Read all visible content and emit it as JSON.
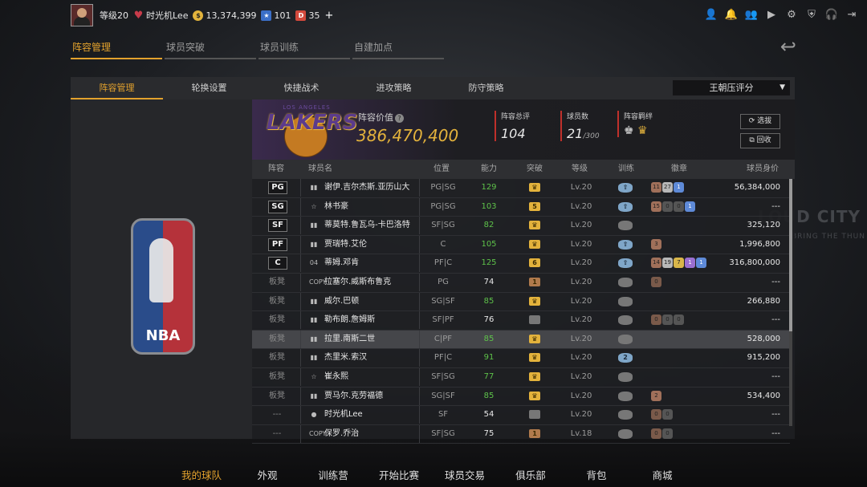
{
  "topbar": {
    "level": "等级20",
    "username": "时光机Lee",
    "coins": "13,374,399",
    "stars": "101",
    "tickets": "35",
    "plus": "+"
  },
  "top_tabs": [
    "阵容管理",
    "球员突破",
    "球员训练",
    "自建加点"
  ],
  "sub_tabs": [
    "阵容管理",
    "轮换设置",
    "快捷战术",
    "进攻策略",
    "防守策略"
  ],
  "sort_select": "王朝压评分",
  "team": {
    "logo_top_text": "LOS ANGELES",
    "logo_word": "LAKERS",
    "value_label": "阵容价值",
    "value": "386,470,400",
    "overall_label": "阵容总评",
    "overall": "104",
    "players_label": "球员数",
    "players": "21",
    "players_max": "/300",
    "bonds_label": "阵容羁绊",
    "btn_select": "选拔",
    "btn_recycle": "回收"
  },
  "left_logo": "NBA",
  "bg_text": "LOUD CITY",
  "bg_text2": "BRING THE THUN",
  "columns": [
    "阵容",
    "球员名",
    "位置",
    "能力",
    "突破",
    "等级",
    "训练",
    "徽章",
    "球员身价"
  ],
  "rows": [
    {
      "slot": "PG",
      "type": "bar",
      "name": "谢伊.吉尔杰斯.亚历山大",
      "pos": "PG|SG",
      "rating": "129",
      "green": true,
      "brk": "crown",
      "level": "Lv.20",
      "train": "up",
      "badges": [
        [
          "11",
          "br"
        ],
        [
          "27",
          "si"
        ],
        [
          "1",
          "bl"
        ]
      ],
      "worth": "56,384,000"
    },
    {
      "slot": "SG",
      "type": "star",
      "name": "林书豪",
      "pos": "PG|SG",
      "rating": "103",
      "green": true,
      "brk": "5",
      "level": "Lv.20",
      "train": "up",
      "badges": [
        [
          "15",
          "br"
        ],
        [
          "0",
          "dk"
        ],
        [
          "0",
          "dk"
        ],
        [
          "1",
          "bl"
        ]
      ],
      "worth": "---"
    },
    {
      "slot": "SF",
      "type": "bar",
      "name": "蒂莫特.鲁瓦乌-卡巴洛特",
      "pos": "SF|SG",
      "rating": "82",
      "green": true,
      "brk": "crown",
      "level": "Lv.20",
      "train": "n",
      "badges": [],
      "worth": "325,120"
    },
    {
      "slot": "PF",
      "type": "bar",
      "name": "贾瑞特.艾伦",
      "pos": "C",
      "rating": "105",
      "green": true,
      "brk": "crown",
      "level": "Lv.20",
      "train": "up",
      "badges": [
        [
          "3",
          "br"
        ]
      ],
      "worth": "1,996,800"
    },
    {
      "slot": "C",
      "type": "04",
      "name": "蒂姆.邓肯",
      "pos": "PF|C",
      "rating": "125",
      "green": true,
      "brk": "6",
      "level": "Lv.20",
      "train": "up",
      "badges": [
        [
          "14",
          "br"
        ],
        [
          "19",
          "si"
        ],
        [
          "7",
          "go"
        ],
        [
          "1",
          "pu"
        ],
        [
          "1",
          "bl"
        ]
      ],
      "worth": "316,800,000"
    },
    {
      "slot": "板凳",
      "type": "COPY",
      "name": "拉塞尔.威斯布鲁克",
      "pos": "PG",
      "rating": "74",
      "green": false,
      "brk": "brown",
      "level": "Lv.20",
      "train": "n",
      "badges": [
        [
          "0",
          "brd"
        ]
      ],
      "worth": "---"
    },
    {
      "slot": "板凳",
      "type": "bar",
      "name": "威尔.巴顿",
      "pos": "SG|SF",
      "rating": "85",
      "green": true,
      "brk": "crown",
      "level": "Lv.20",
      "train": "n",
      "badges": [],
      "worth": "266,880"
    },
    {
      "slot": "板凳",
      "type": "bar",
      "name": "勒布朗.詹姆斯",
      "pos": "SF|PF",
      "rating": "76",
      "green": false,
      "brk": "n",
      "level": "Lv.20",
      "train": "n",
      "badges": [
        [
          "0",
          "brd"
        ],
        [
          "0",
          "dk"
        ],
        [
          "0",
          "dk"
        ]
      ],
      "worth": "---"
    },
    {
      "slot": "板凳",
      "type": "bar",
      "name": "拉里.南斯二世",
      "pos": "C|PF",
      "rating": "85",
      "green": true,
      "brk": "crown",
      "level": "Lv.20",
      "train": "n",
      "badges": [],
      "worth": "528,000",
      "selected": true
    },
    {
      "slot": "板凳",
      "type": "bar",
      "name": "杰里米.索汉",
      "pos": "PF|C",
      "rating": "91",
      "green": true,
      "brk": "crown",
      "level": "Lv.20",
      "train": "2",
      "badges": [],
      "worth": "915,200"
    },
    {
      "slot": "板凳",
      "type": "star",
      "name": "崔永熙",
      "pos": "SF|SG",
      "rating": "77",
      "green": true,
      "brk": "crown",
      "level": "Lv.20",
      "train": "n",
      "badges": [],
      "worth": "---"
    },
    {
      "slot": "板凳",
      "type": "bar",
      "name": "贾马尔.克劳福德",
      "pos": "SG|SF",
      "rating": "85",
      "green": true,
      "brk": "crown",
      "level": "Lv.20",
      "train": "n",
      "badges": [
        [
          "2",
          "br"
        ]
      ],
      "worth": "534,400"
    },
    {
      "slot": "---",
      "type": "person",
      "name": "时光机Lee",
      "pos": "SF",
      "rating": "54",
      "green": false,
      "brk": "n",
      "level": "Lv.20",
      "train": "n",
      "badges": [
        [
          "0",
          "brd"
        ],
        [
          "0",
          "dk"
        ]
      ],
      "worth": "---"
    },
    {
      "slot": "---",
      "type": "COPY",
      "name": "保罗.乔治",
      "pos": "SF|SG",
      "rating": "75",
      "green": false,
      "brk": "brown",
      "level": "Lv.18",
      "train": "n",
      "badges": [
        [
          "0",
          "brd"
        ],
        [
          "0",
          "dk"
        ]
      ],
      "worth": "---"
    }
  ],
  "bottom_nav": [
    "我的球队",
    "外观",
    "训练营",
    "开始比赛",
    "球员交易",
    "俱乐部",
    "背包",
    "商城"
  ],
  "colors": {
    "accent": "#e3a22d",
    "green": "#5ec24a",
    "value": "#e3b23c"
  }
}
